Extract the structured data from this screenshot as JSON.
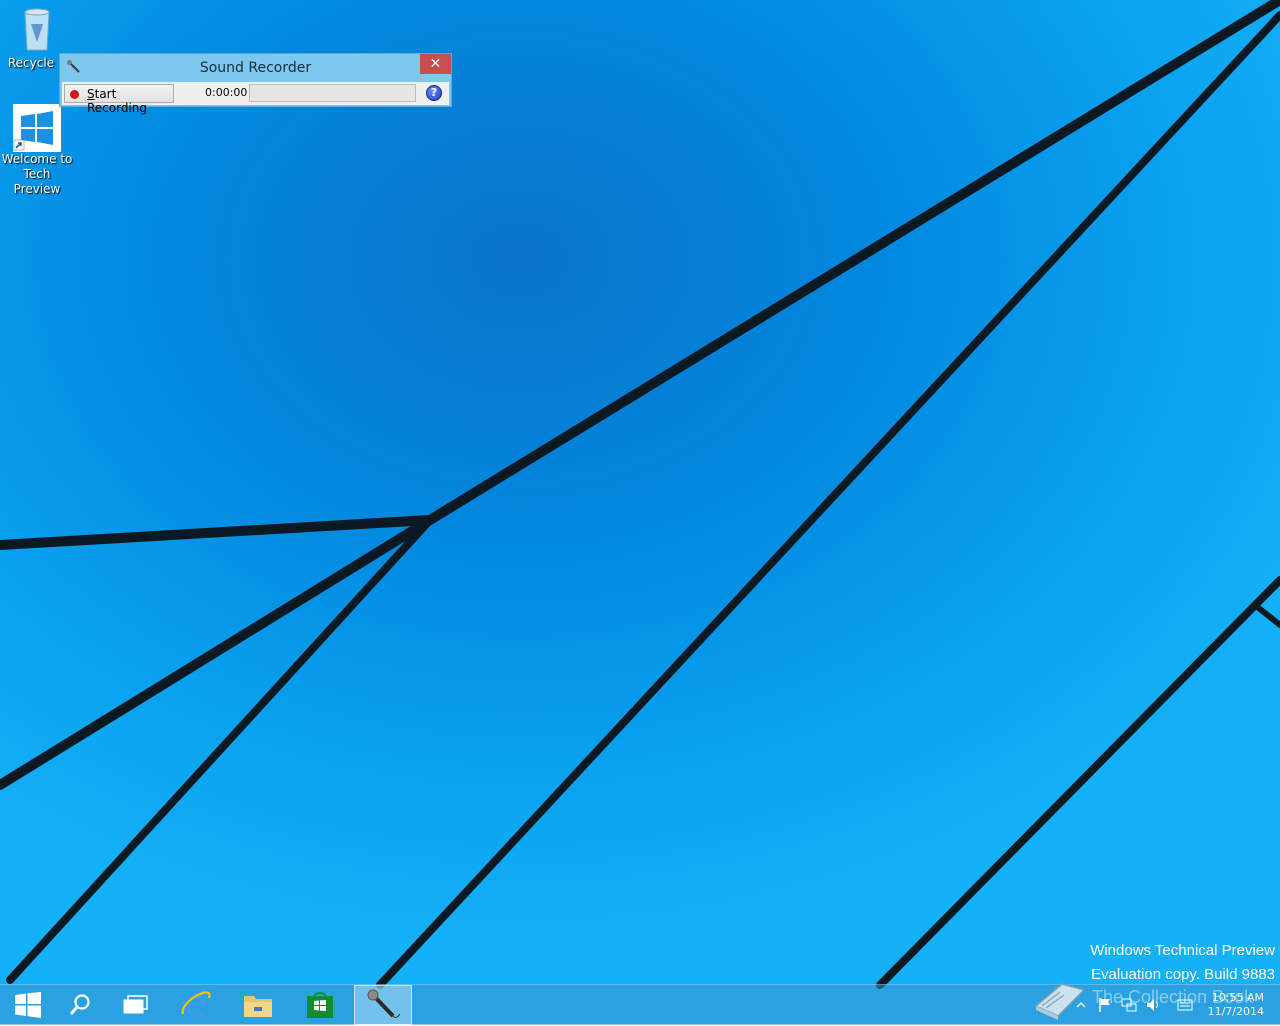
{
  "desktop": {
    "icons": [
      {
        "label": "Recycle B",
        "icon": "recycle-bin-icon"
      },
      {
        "label": "Welcome to Tech Preview",
        "icon": "windows-logo-icon"
      }
    ]
  },
  "sound_recorder": {
    "title": "Sound Recorder",
    "close_glyph": "✕",
    "start_button": {
      "underlined": "S",
      "rest": "tart Recording"
    },
    "elapsed_time": "0:00:00",
    "help_glyph": "?"
  },
  "watermark": {
    "line1": "Windows Technical Preview",
    "line2": "Evaluation copy. Build 9883"
  },
  "overlay": {
    "collection_text": "The Collection Book"
  },
  "taskbar": {
    "buttons": [
      "start-button",
      "search-button",
      "task-view-button",
      "internet-explorer-button",
      "file-explorer-button",
      "store-button",
      "sound-recorder-button"
    ],
    "clock_time": "10:55 AM",
    "clock_date": "11/7/2014"
  },
  "colors": {
    "desktop_blue": "#0aa3f0",
    "close_red": "#c7504b",
    "titlebar": "#7cc8ef",
    "record_dot": "#d2141b"
  }
}
